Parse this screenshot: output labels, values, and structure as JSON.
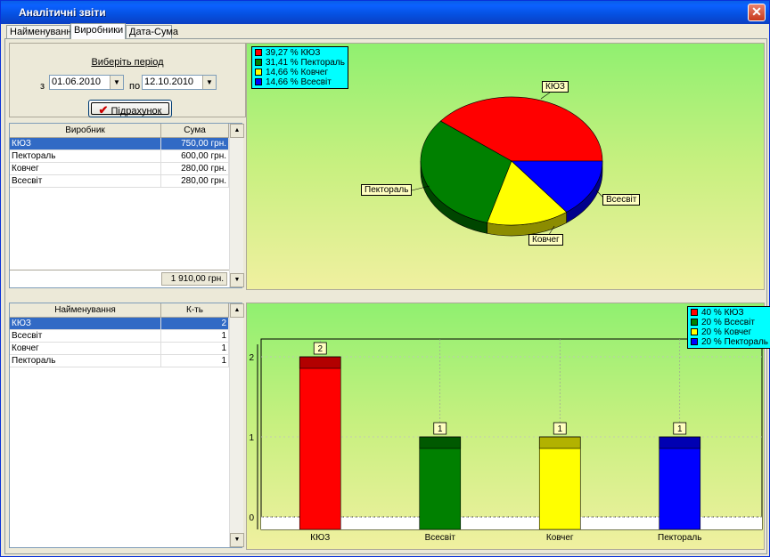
{
  "window": {
    "title": "Аналітичні звіти",
    "close": "✕"
  },
  "tabs": [
    "Найменування",
    "Виробники",
    "Дата-Сума"
  ],
  "period": {
    "title": "Виберіть період",
    "from_label": "з",
    "from_value": "01.06.2010",
    "to_label": "по",
    "to_value": "12.10.2010",
    "calc_button": "Підрахунок"
  },
  "producers_table": {
    "headers": [
      "Виробник",
      "Сума"
    ],
    "rows": [
      [
        "КЮЗ",
        "750,00 грн."
      ],
      [
        "Пектораль",
        "600,00 грн."
      ],
      [
        "Ковчег",
        "280,00 грн."
      ],
      [
        "Всесвіт",
        "280,00 грн."
      ]
    ],
    "total": "1 910,00 грн."
  },
  "names_table": {
    "headers": [
      "Найменування",
      "К-ть"
    ],
    "rows": [
      [
        "КЮЗ",
        "2"
      ],
      [
        "Всесвіт",
        "1"
      ],
      [
        "Ковчег",
        "1"
      ],
      [
        "Пектораль",
        "1"
      ]
    ]
  },
  "colors": {
    "red": "#ff0000",
    "green": "#008000",
    "yellow": "#ffff00",
    "blue": "#0000ff"
  },
  "chart_data": [
    {
      "type": "pie",
      "categories": [
        "КЮЗ",
        "Пектораль",
        "Ковчег",
        "Всесвіт"
      ],
      "values": [
        39.27,
        31.41,
        14.66,
        14.66
      ],
      "legend": [
        "39,27 % КЮЗ",
        "31,41 % Пектораль",
        "14,66 % Ковчег",
        "14,66 % Всесвіт"
      ],
      "legend_position": "top-left",
      "colors": [
        "#ff0000",
        "#008000",
        "#ffff00",
        "#0000ff"
      ]
    },
    {
      "type": "bar",
      "categories": [
        "КЮЗ",
        "Всесвіт",
        "Ковчег",
        "Пектораль"
      ],
      "values": [
        2,
        1,
        1,
        1
      ],
      "data_labels": [
        "2",
        "1",
        "1",
        "1"
      ],
      "yticks": [
        "0",
        "1",
        "2"
      ],
      "ylim": [
        0,
        2.5
      ],
      "legend": [
        "40 % КЮЗ",
        "20 % Всесвіт",
        "20 % Ковчег",
        "20 % Пектораль"
      ],
      "legend_position": "top-right",
      "colors": [
        "#ff0000",
        "#008000",
        "#ffff00",
        "#0000ff"
      ],
      "grid": true
    }
  ]
}
